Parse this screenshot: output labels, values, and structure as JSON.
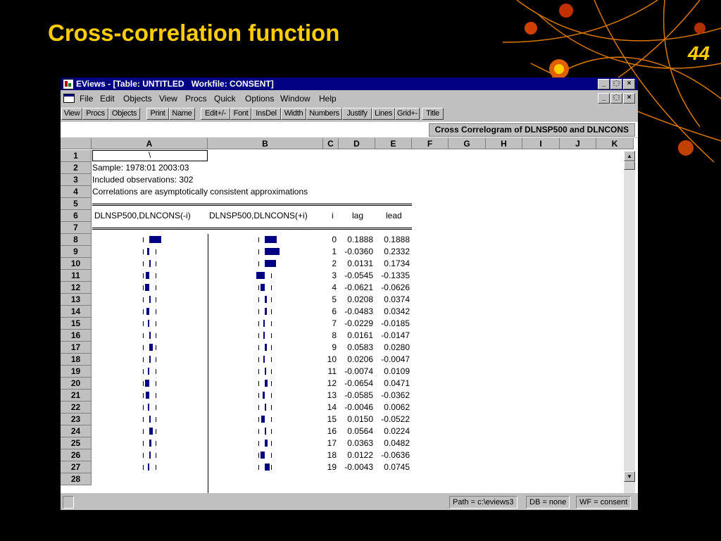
{
  "slide": {
    "title": "Cross-correlation function",
    "number": "44"
  },
  "window": {
    "title": "EViews - [Table: UNTITLED   Workfile: CONSENT]",
    "minimize": "_",
    "restore": "҈",
    "close": "×"
  },
  "menu": [
    "File",
    "Edit",
    "Objects",
    "View",
    "Procs",
    "Quick",
    "Options",
    "Window",
    "Help"
  ],
  "toolbar": [
    "View",
    "Procs",
    "Objects",
    "Print",
    "Name",
    "Edit+/-",
    "Font",
    "InsDel",
    "Width",
    "Numbers",
    "Justify",
    "Lines",
    "Grid+-",
    "Title"
  ],
  "table_title": "Cross Correlogram of DLNSP500 and DLNCONS",
  "columns": [
    "A",
    "B",
    "C",
    "D",
    "E",
    "F",
    "G",
    "H",
    "I",
    "J",
    "K"
  ],
  "rows": [
    "1",
    "2",
    "3",
    "4",
    "5",
    "6",
    "7",
    "8",
    "9",
    "10",
    "11",
    "12",
    "13",
    "14",
    "15",
    "16",
    "17",
    "18",
    "19",
    "20",
    "21",
    "22",
    "23",
    "24",
    "25",
    "26",
    "27",
    "28"
  ],
  "cell_a1": "\\",
  "info_lines": [
    "Sample: 1978:01 2003:03",
    "Included observations: 302",
    "Correlations are asymptotically consistent approximations"
  ],
  "headers": {
    "col_a": "DLNSP500,DLNCONS(-i)",
    "col_b": "DLNSP500,DLNCONS(+i)",
    "i": "i",
    "lag": "lag",
    "lead": "lead"
  },
  "chart_data": {
    "type": "table",
    "columns": [
      "i",
      "lag",
      "lead"
    ],
    "rows": [
      [
        0,
        "0.1888",
        "0.1888"
      ],
      [
        1,
        "-0.0360",
        "0.2332"
      ],
      [
        2,
        "0.0131",
        "0.1734"
      ],
      [
        3,
        "-0.0545",
        "-0.1335"
      ],
      [
        4,
        "-0.0621",
        "-0.0626"
      ],
      [
        5,
        "0.0208",
        "0.0374"
      ],
      [
        6,
        "-0.0483",
        "0.0342"
      ],
      [
        7,
        "-0.0229",
        "-0.0185"
      ],
      [
        8,
        "0.0161",
        "-0.0147"
      ],
      [
        9,
        "0.0583",
        "0.0280"
      ],
      [
        10,
        "0.0206",
        "-0.0047"
      ],
      [
        11,
        "-0.0074",
        "0.0109"
      ],
      [
        12,
        "-0.0654",
        "0.0471"
      ],
      [
        13,
        "-0.0585",
        "-0.0362"
      ],
      [
        14,
        "-0.0046",
        "0.0062"
      ],
      [
        15,
        "0.0150",
        "-0.0522"
      ],
      [
        16,
        "0.0564",
        "0.0224"
      ],
      [
        17,
        "0.0363",
        "0.0482"
      ],
      [
        18,
        "0.0122",
        "-0.0636"
      ],
      [
        19,
        "-0.0043",
        "0.0745"
      ]
    ],
    "bar_color": "#000080"
  },
  "status": {
    "path": "Path = c:\\eviews3",
    "db": "DB = none",
    "wf": "WF = consent"
  },
  "colors": {
    "title": "#ffcc00",
    "titlebar": "#000080",
    "background": "#000000"
  }
}
